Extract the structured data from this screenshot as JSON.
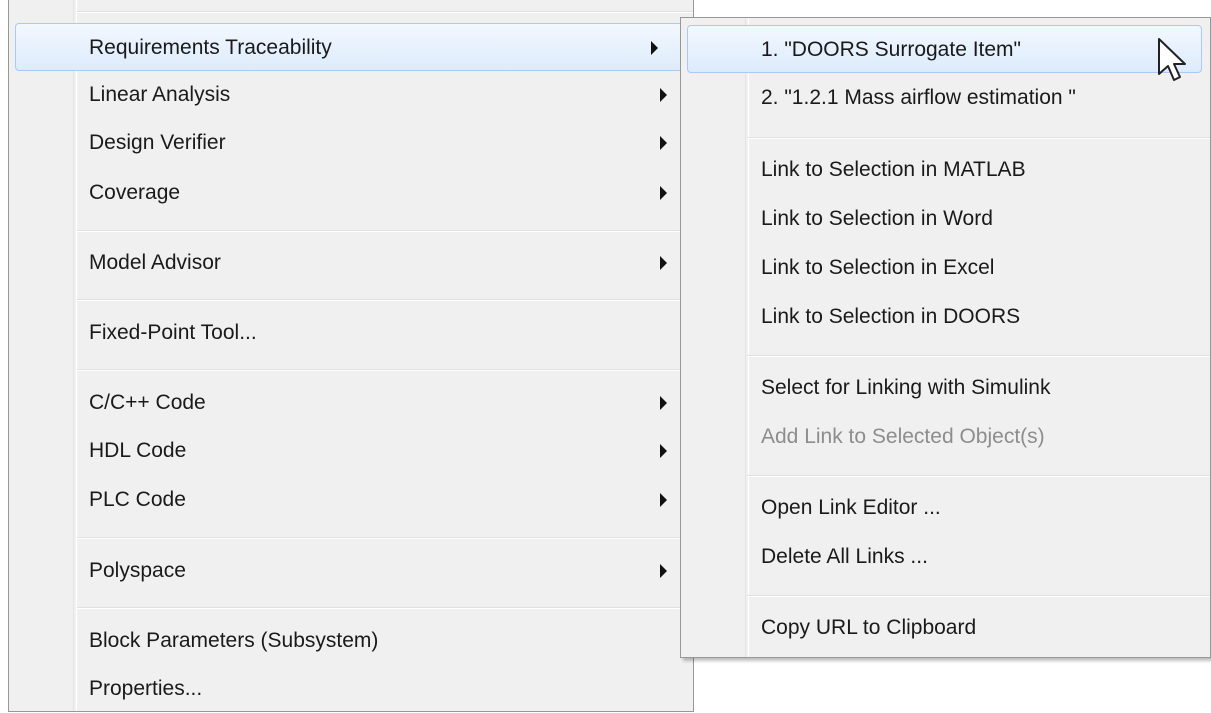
{
  "main_menu": {
    "items": [
      {
        "label": "Requirements Traceability",
        "submenu": true
      },
      {
        "label": "Linear Analysis",
        "submenu": true
      },
      {
        "label": "Design Verifier",
        "submenu": true
      },
      {
        "label": "Coverage",
        "submenu": true
      },
      {
        "label": "Model Advisor",
        "submenu": true
      },
      {
        "label": "Fixed-Point Tool...",
        "submenu": false
      },
      {
        "label": "C/C++ Code",
        "submenu": true
      },
      {
        "label": "HDL Code",
        "submenu": true
      },
      {
        "label": "PLC Code",
        "submenu": true
      },
      {
        "label": "Polyspace",
        "submenu": true
      },
      {
        "label": "Block Parameters (Subsystem)",
        "submenu": false
      },
      {
        "label": "Properties...",
        "submenu": false
      }
    ],
    "highlighted": "Requirements Traceability"
  },
  "submenu": {
    "items": [
      {
        "label": "1. \"DOORS Surrogate Item\""
      },
      {
        "label": "2. \"1.2.1  Mass airflow estimation \""
      },
      {
        "label": "Link to Selection in MATLAB"
      },
      {
        "label": "Link to Selection in Word"
      },
      {
        "label": "Link to Selection in Excel"
      },
      {
        "label": "Link to Selection in DOORS"
      },
      {
        "label": "Select for Linking with Simulink"
      },
      {
        "label": "Add Link to Selected Object(s)",
        "disabled": true
      },
      {
        "label": "Open Link Editor ..."
      },
      {
        "label": "Delete All Links ..."
      },
      {
        "label": "Copy URL to Clipboard"
      }
    ],
    "highlighted": "1. \"DOORS Surrogate Item\""
  },
  "colors": {
    "menu_background": "#f0f0f0",
    "highlight_border": "#a9cbf1",
    "disabled_text": "#8d8d8d"
  }
}
